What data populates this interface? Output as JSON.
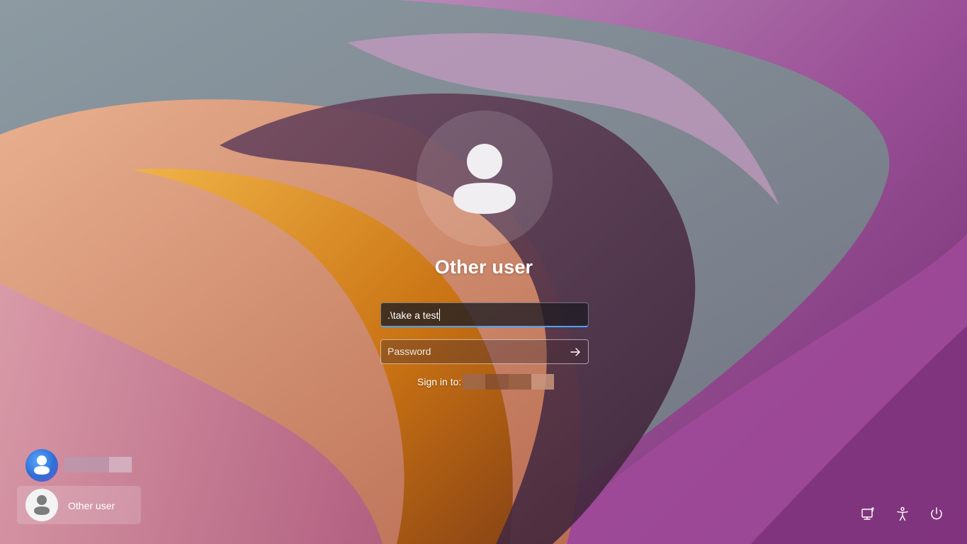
{
  "login": {
    "user_display_name": "Other user",
    "username_value": ".\\take a test",
    "password_placeholder": "Password",
    "sign_in_label": "Sign in to:"
  },
  "user_list": {
    "items": [
      {
        "label": ""
      },
      {
        "label": "Other user",
        "selected": true
      }
    ]
  },
  "corner_controls": [
    {
      "icon": "network-icon"
    },
    {
      "icon": "accessibility-icon"
    },
    {
      "icon": "power-icon"
    }
  ],
  "colors": {
    "focus_accent": "#4aa3ff",
    "small_avatar_blue": "#2f6fd6"
  }
}
